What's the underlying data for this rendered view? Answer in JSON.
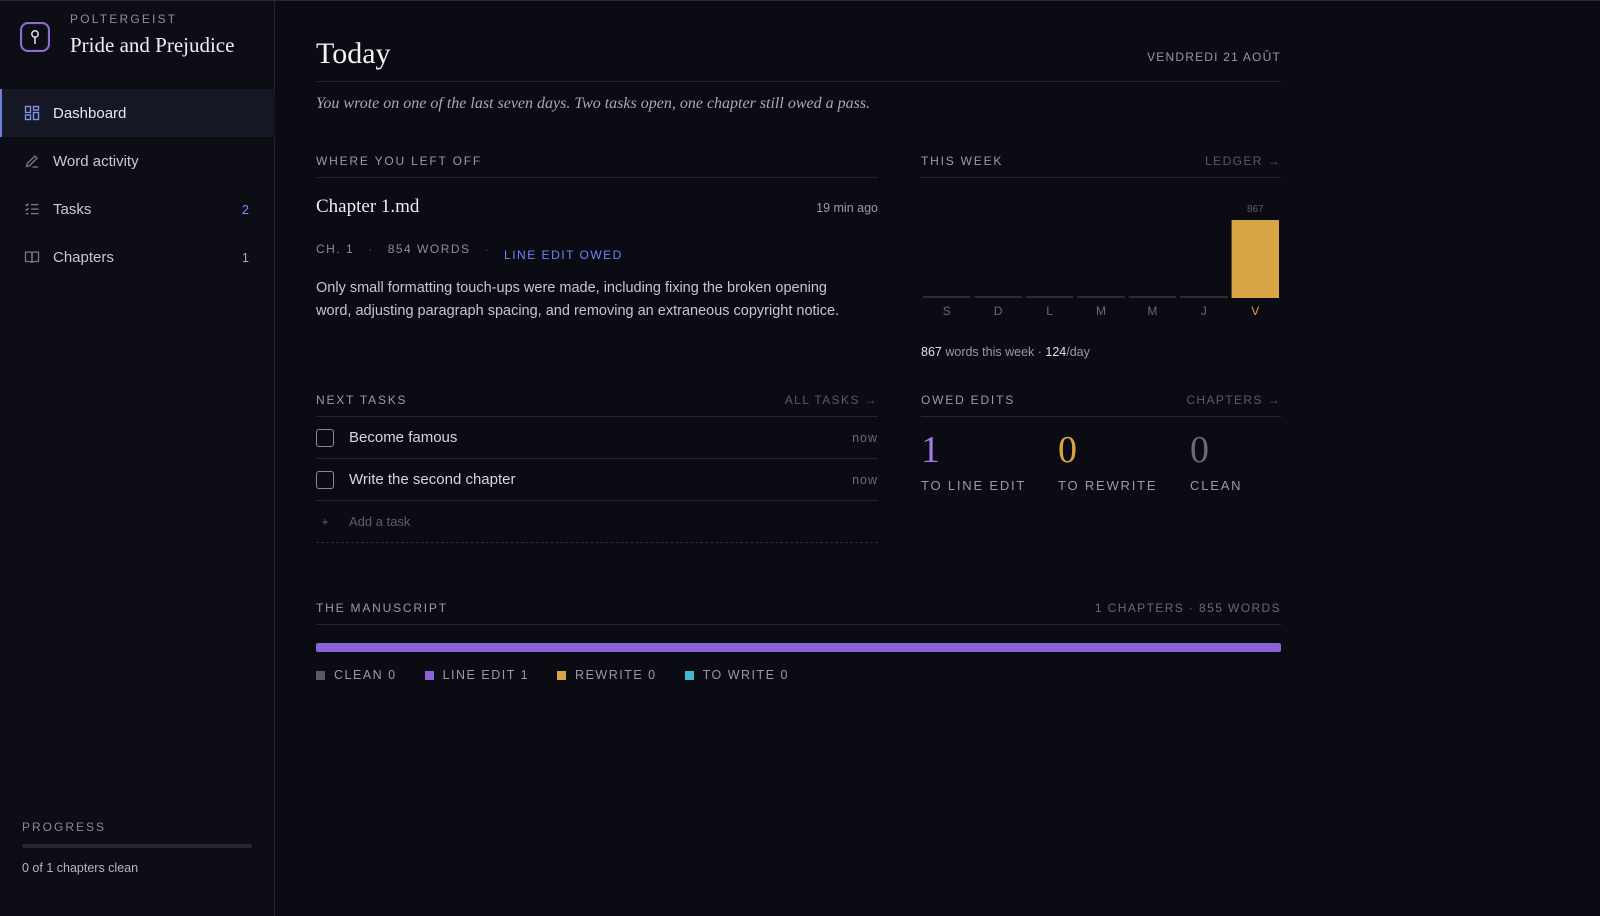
{
  "brand": {
    "kicker": "POLTERGEIST",
    "title": "Pride and Prejudice"
  },
  "nav": {
    "items": [
      {
        "label": "Dashboard",
        "icon": "dashboard-icon",
        "count": ""
      },
      {
        "label": "Word activity",
        "icon": "pencil-icon",
        "count": ""
      },
      {
        "label": "Tasks",
        "icon": "checklist-icon",
        "count": "2"
      },
      {
        "label": "Chapters",
        "icon": "book-icon",
        "count": "1"
      }
    ]
  },
  "progress": {
    "label": "PROGRESS",
    "text": "0 of 1 chapters clean",
    "fraction": 0
  },
  "header": {
    "title": "Today",
    "date": "VENDREDI 21 AOÛT"
  },
  "summary": "You wrote on one of the last seven days. Two tasks open, one chapter still owed a pass.",
  "left_off": {
    "heading": "WHERE YOU LEFT OFF",
    "file": "Chapter 1.md",
    "time": "19 min ago",
    "chapter": "CH. 1",
    "words": "854 WORDS",
    "status": "LINE EDIT OWED",
    "description": "Only small formatting touch-ups were made, including fixing the broken opening word, adjusting paragraph spacing, and removing an extraneous copyright notice."
  },
  "week": {
    "heading": "THIS WEEK",
    "link": "LEDGER →",
    "words_total": "867",
    "words_suffix": "words this week ·",
    "per_day": "124",
    "per_day_suffix": "/day"
  },
  "chart_data": {
    "type": "bar",
    "categories": [
      "S",
      "D",
      "L",
      "M",
      "M",
      "J",
      "V"
    ],
    "values": [
      0,
      0,
      0,
      0,
      0,
      0,
      867
    ],
    "highlight_index": 6,
    "data_labels": [
      "",
      "",
      "",
      "",
      "",
      "",
      "867"
    ],
    "ylim": [
      0,
      867
    ],
    "colors": {
      "bar": "#d8a444",
      "baseline": "#2c2c38",
      "tick": "#6a6a78",
      "tick_active": "#d8a444",
      "label": "#5c5c68"
    }
  },
  "tasks": {
    "heading": "NEXT TASKS",
    "link": "ALL TASKS →",
    "items": [
      {
        "label": "Become famous",
        "when": "now"
      },
      {
        "label": "Write the second chapter",
        "when": "now"
      }
    ],
    "add_label": "Add a task",
    "add_icon": "plus-icon"
  },
  "owed": {
    "heading": "OWED EDITS",
    "link": "CHAPTERS →",
    "items": [
      {
        "value": "1",
        "label": "TO LINE EDIT",
        "color": "#a07be8"
      },
      {
        "value": "0",
        "label": "TO REWRITE",
        "color": "#d8a444"
      },
      {
        "value": "0",
        "label": "CLEAN",
        "color": "#6a6a7a"
      }
    ]
  },
  "manuscript": {
    "heading": "THE MANUSCRIPT",
    "stats": "1 CHAPTERS · 855 WORDS",
    "segments": [
      {
        "label": "CLEAN 0",
        "value": 0,
        "color": "#5a5a66"
      },
      {
        "label": "LINE EDIT 1",
        "value": 1,
        "color": "#8c62d8"
      },
      {
        "label": "REWRITE 0",
        "value": 0,
        "color": "#d8a444"
      },
      {
        "label": "TO WRITE 0",
        "value": 0,
        "color": "#3fb8d0"
      }
    ]
  }
}
